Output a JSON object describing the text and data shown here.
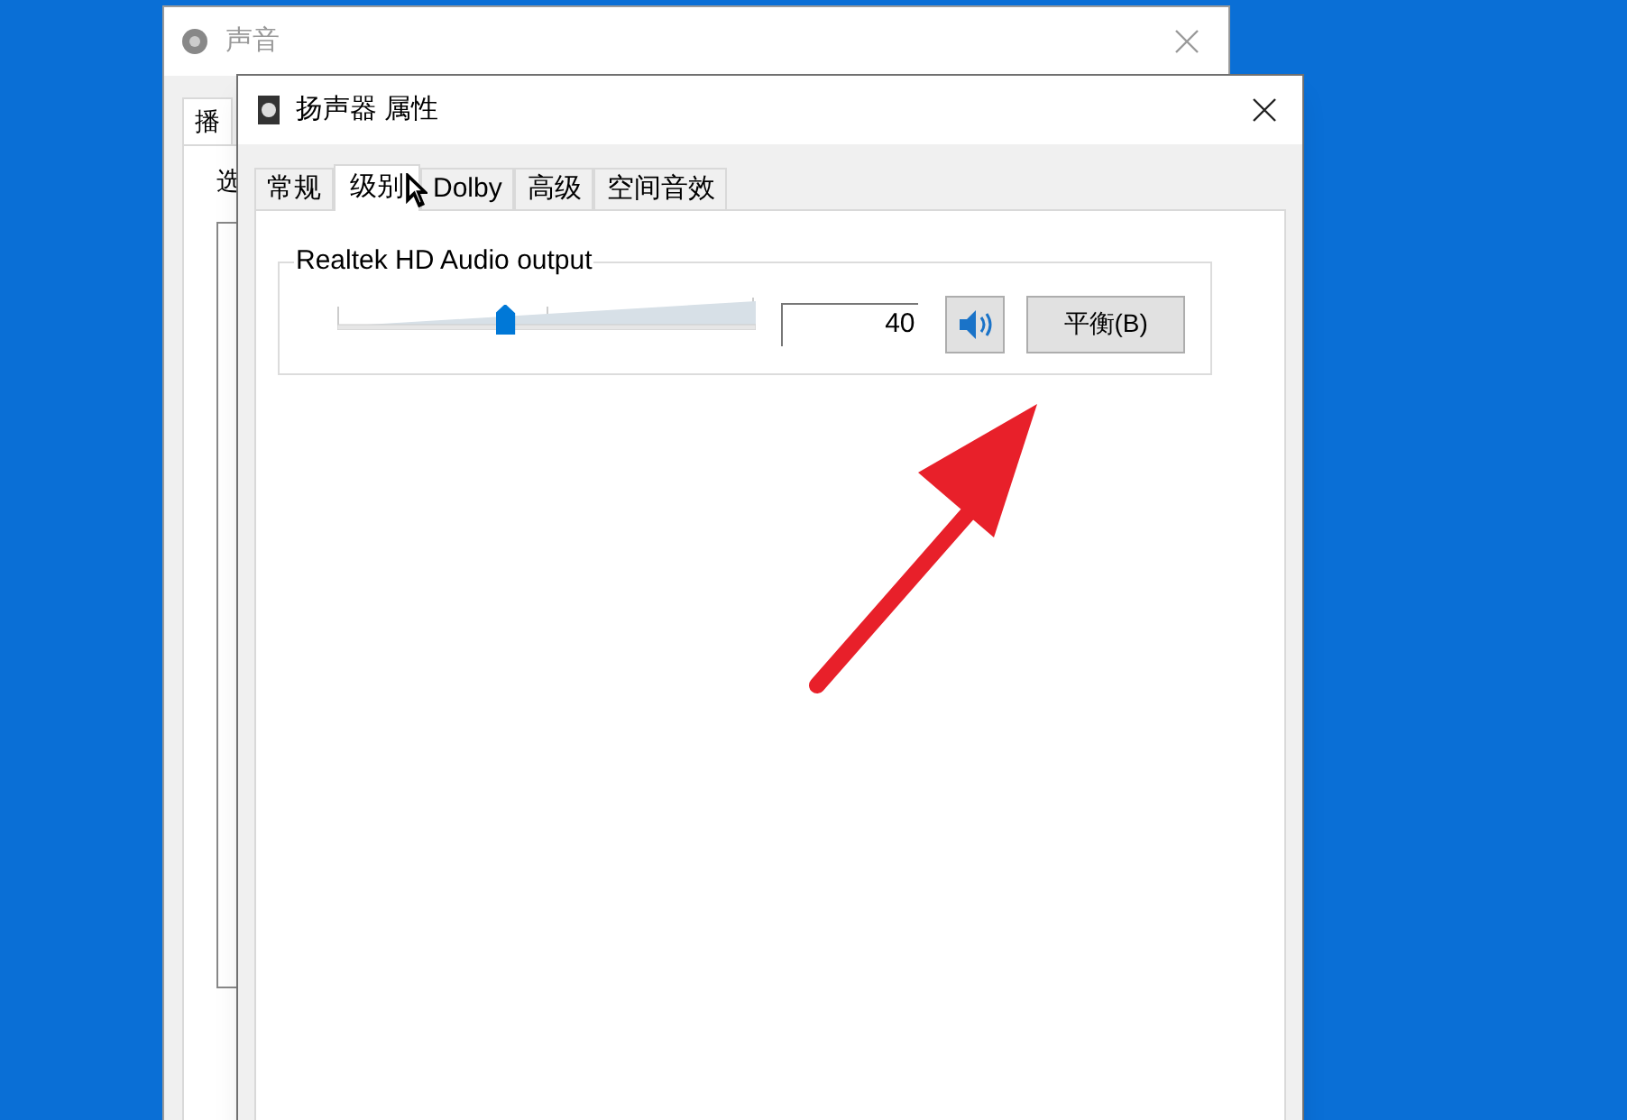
{
  "back_window": {
    "title": "声音",
    "tab": "播",
    "label": "选"
  },
  "dialog": {
    "title": "扬声器 属性",
    "tabs": [
      {
        "label": "常规",
        "selected": false
      },
      {
        "label": "级别",
        "selected": true
      },
      {
        "label": "Dolby",
        "selected": false
      },
      {
        "label": "高级",
        "selected": false
      },
      {
        "label": "空间音效",
        "selected": false
      }
    ],
    "device": {
      "name": "Realtek HD Audio output",
      "level": 0.4,
      "value": "40",
      "muted": false,
      "balance_button": "平衡(B)"
    }
  }
}
